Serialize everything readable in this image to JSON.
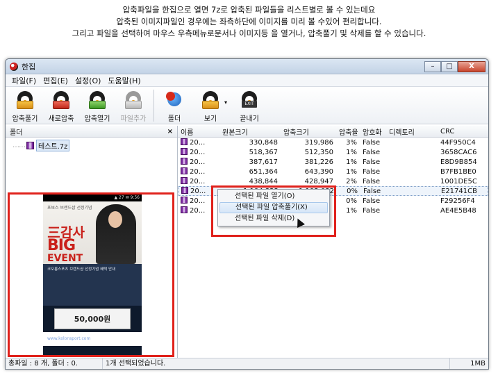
{
  "caption": {
    "line1": "압축파일을 한집으로 열면 7z로 압축된 파일들을 리스트별로 볼 수 있는데요",
    "line2": "압축된 이미지파일인 경우에는 좌측하단에  이미지를 미리 볼 수있어 편리합니다.",
    "line3": "그리고 파일을 선택하여 마우스 우측메뉴로문서나 이미지등 을  열거나, 압축풀기 및 삭제를 할 수 있습니다."
  },
  "window": {
    "title": "한집",
    "controls": {
      "minimize": "–",
      "maximize": "□",
      "close": "X"
    }
  },
  "menu": [
    "파일(F)",
    "편집(E)",
    "설정(O)",
    "도움말(H)"
  ],
  "toolbar": {
    "extract": "압축풀기",
    "new_archive": "새로압축",
    "open_archive": "압축열기",
    "add_file": "파일추가",
    "folder": "폴더",
    "view": "보기",
    "view_dropdown": "▾",
    "exit": "끝내기",
    "exit_box": "EXIT"
  },
  "left_pane": {
    "header": "폴더",
    "close": "×",
    "tree_dots": "……",
    "tree_item": "테스트.7z"
  },
  "preview": {
    "status": "▲ 27 ✉ 9:56",
    "small_text": "포보스\n브랜드샵 선정기념",
    "big1": "三감사",
    "big2": "BIG",
    "big3": "EVENT",
    "mid_text": "코오롱스포츠 브랜드샵 선정기념 혜택 안내",
    "coupon": "50,000원",
    "link": "www.kolonsport.com"
  },
  "list": {
    "columns": {
      "name": "이름",
      "orig": "원본크기",
      "comp": "압축크기",
      "ratio": "압축율",
      "enc": "암호화",
      "dir": "디렉토리",
      "crc": "CRC"
    },
    "rows": [
      {
        "name": "20...",
        "orig": "330,848",
        "comp": "319,986",
        "ratio": "3%",
        "enc": "False",
        "crc": "44F950C4"
      },
      {
        "name": "20...",
        "orig": "518,367",
        "comp": "512,350",
        "ratio": "1%",
        "enc": "False",
        "crc": "3658CAC6"
      },
      {
        "name": "20...",
        "orig": "387,617",
        "comp": "381,226",
        "ratio": "1%",
        "enc": "False",
        "crc": "E8D9B854"
      },
      {
        "name": "20...",
        "orig": "651,364",
        "comp": "643,390",
        "ratio": "1%",
        "enc": "False",
        "crc": "B7FB1BE0"
      },
      {
        "name": "20...",
        "orig": "438,844",
        "comp": "428,947",
        "ratio": "2%",
        "enc": "False",
        "crc": "1001DE5C"
      },
      {
        "name": "20...",
        "orig": "1,194,322",
        "comp": "1,192,032",
        "ratio": "0%",
        "enc": "False",
        "crc": "E21741CB"
      },
      {
        "name": "20...",
        "orig": "",
        "comp": "",
        "ratio": "0%",
        "enc": "False",
        "crc": "F29256F4"
      },
      {
        "name": "20...",
        "orig": "",
        "comp": "",
        "ratio": "1%",
        "enc": "False",
        "crc": "AE4E5B48"
      }
    ]
  },
  "context_menu": {
    "open": "선택된 파일 열기(O)",
    "extract": "선택된 파일 압축풀기(X)",
    "delete": "선택된 파일 삭제(D)"
  },
  "status": {
    "total": "총파일 : 8 개, 폴더 : 0.",
    "selected": "1개 선택되었습니다.",
    "size": "1MB"
  }
}
